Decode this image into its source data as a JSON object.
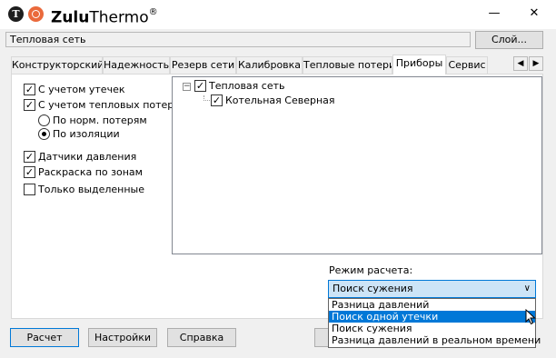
{
  "app": {
    "title_bold": "Zulu",
    "title_rest": "Thermo",
    "title_mark": "®",
    "logo_letter": "T"
  },
  "window": {
    "minimize_glyph": "—",
    "close_glyph": "✕"
  },
  "network": {
    "name": "Тепловая сеть"
  },
  "layer_button": "Слой...",
  "tabs": [
    {
      "label": "Конструкторский",
      "active": false
    },
    {
      "label": "Надежность",
      "active": false
    },
    {
      "label": "Резерв сети",
      "active": false
    },
    {
      "label": "Калибровка",
      "active": false
    },
    {
      "label": "Тепловые потери",
      "active": false
    },
    {
      "label": "Приборы",
      "active": true
    },
    {
      "label": "Сервис",
      "active": false
    }
  ],
  "tab_scroll": {
    "left": "◀",
    "right": "▶"
  },
  "options": {
    "leaks": {
      "label": "С учетом утечек",
      "checked": true
    },
    "heat_loss": {
      "label": "С учетом тепловых потерь",
      "checked": true
    },
    "radio_norm": {
      "label": "По норм. потерям",
      "selected": false
    },
    "radio_insulation": {
      "label": "По изоляции",
      "selected": true
    },
    "pressure_sensors": {
      "label": "Датчики давления",
      "checked": true
    },
    "zone_coloring": {
      "label": "Раскраска по зонам",
      "checked": true
    },
    "selected_only": {
      "label": "Только выделенные",
      "checked": false
    }
  },
  "tree": {
    "root": {
      "label": "Тепловая сеть",
      "checked": true,
      "expander": "−"
    },
    "child": {
      "label": "Котельная Северная",
      "checked": true
    }
  },
  "mode": {
    "label": "Режим расчета:",
    "current": "Поиск сужения",
    "arrow": "∨",
    "options": [
      {
        "label": "Разница давлений",
        "highlighted": false
      },
      {
        "label": "Поиск одной утечки",
        "highlighted": true
      },
      {
        "label": "Поиск сужения",
        "highlighted": false
      },
      {
        "label": "Разница давлений в реальном времени",
        "highlighted": false
      }
    ]
  },
  "buttons": {
    "calculate": "Расчет",
    "settings": "Настройки",
    "help": "Справка"
  },
  "check_glyph": "✓",
  "colors": {
    "accent": "#0078d7",
    "logo_orange": "#ea6a3c"
  }
}
